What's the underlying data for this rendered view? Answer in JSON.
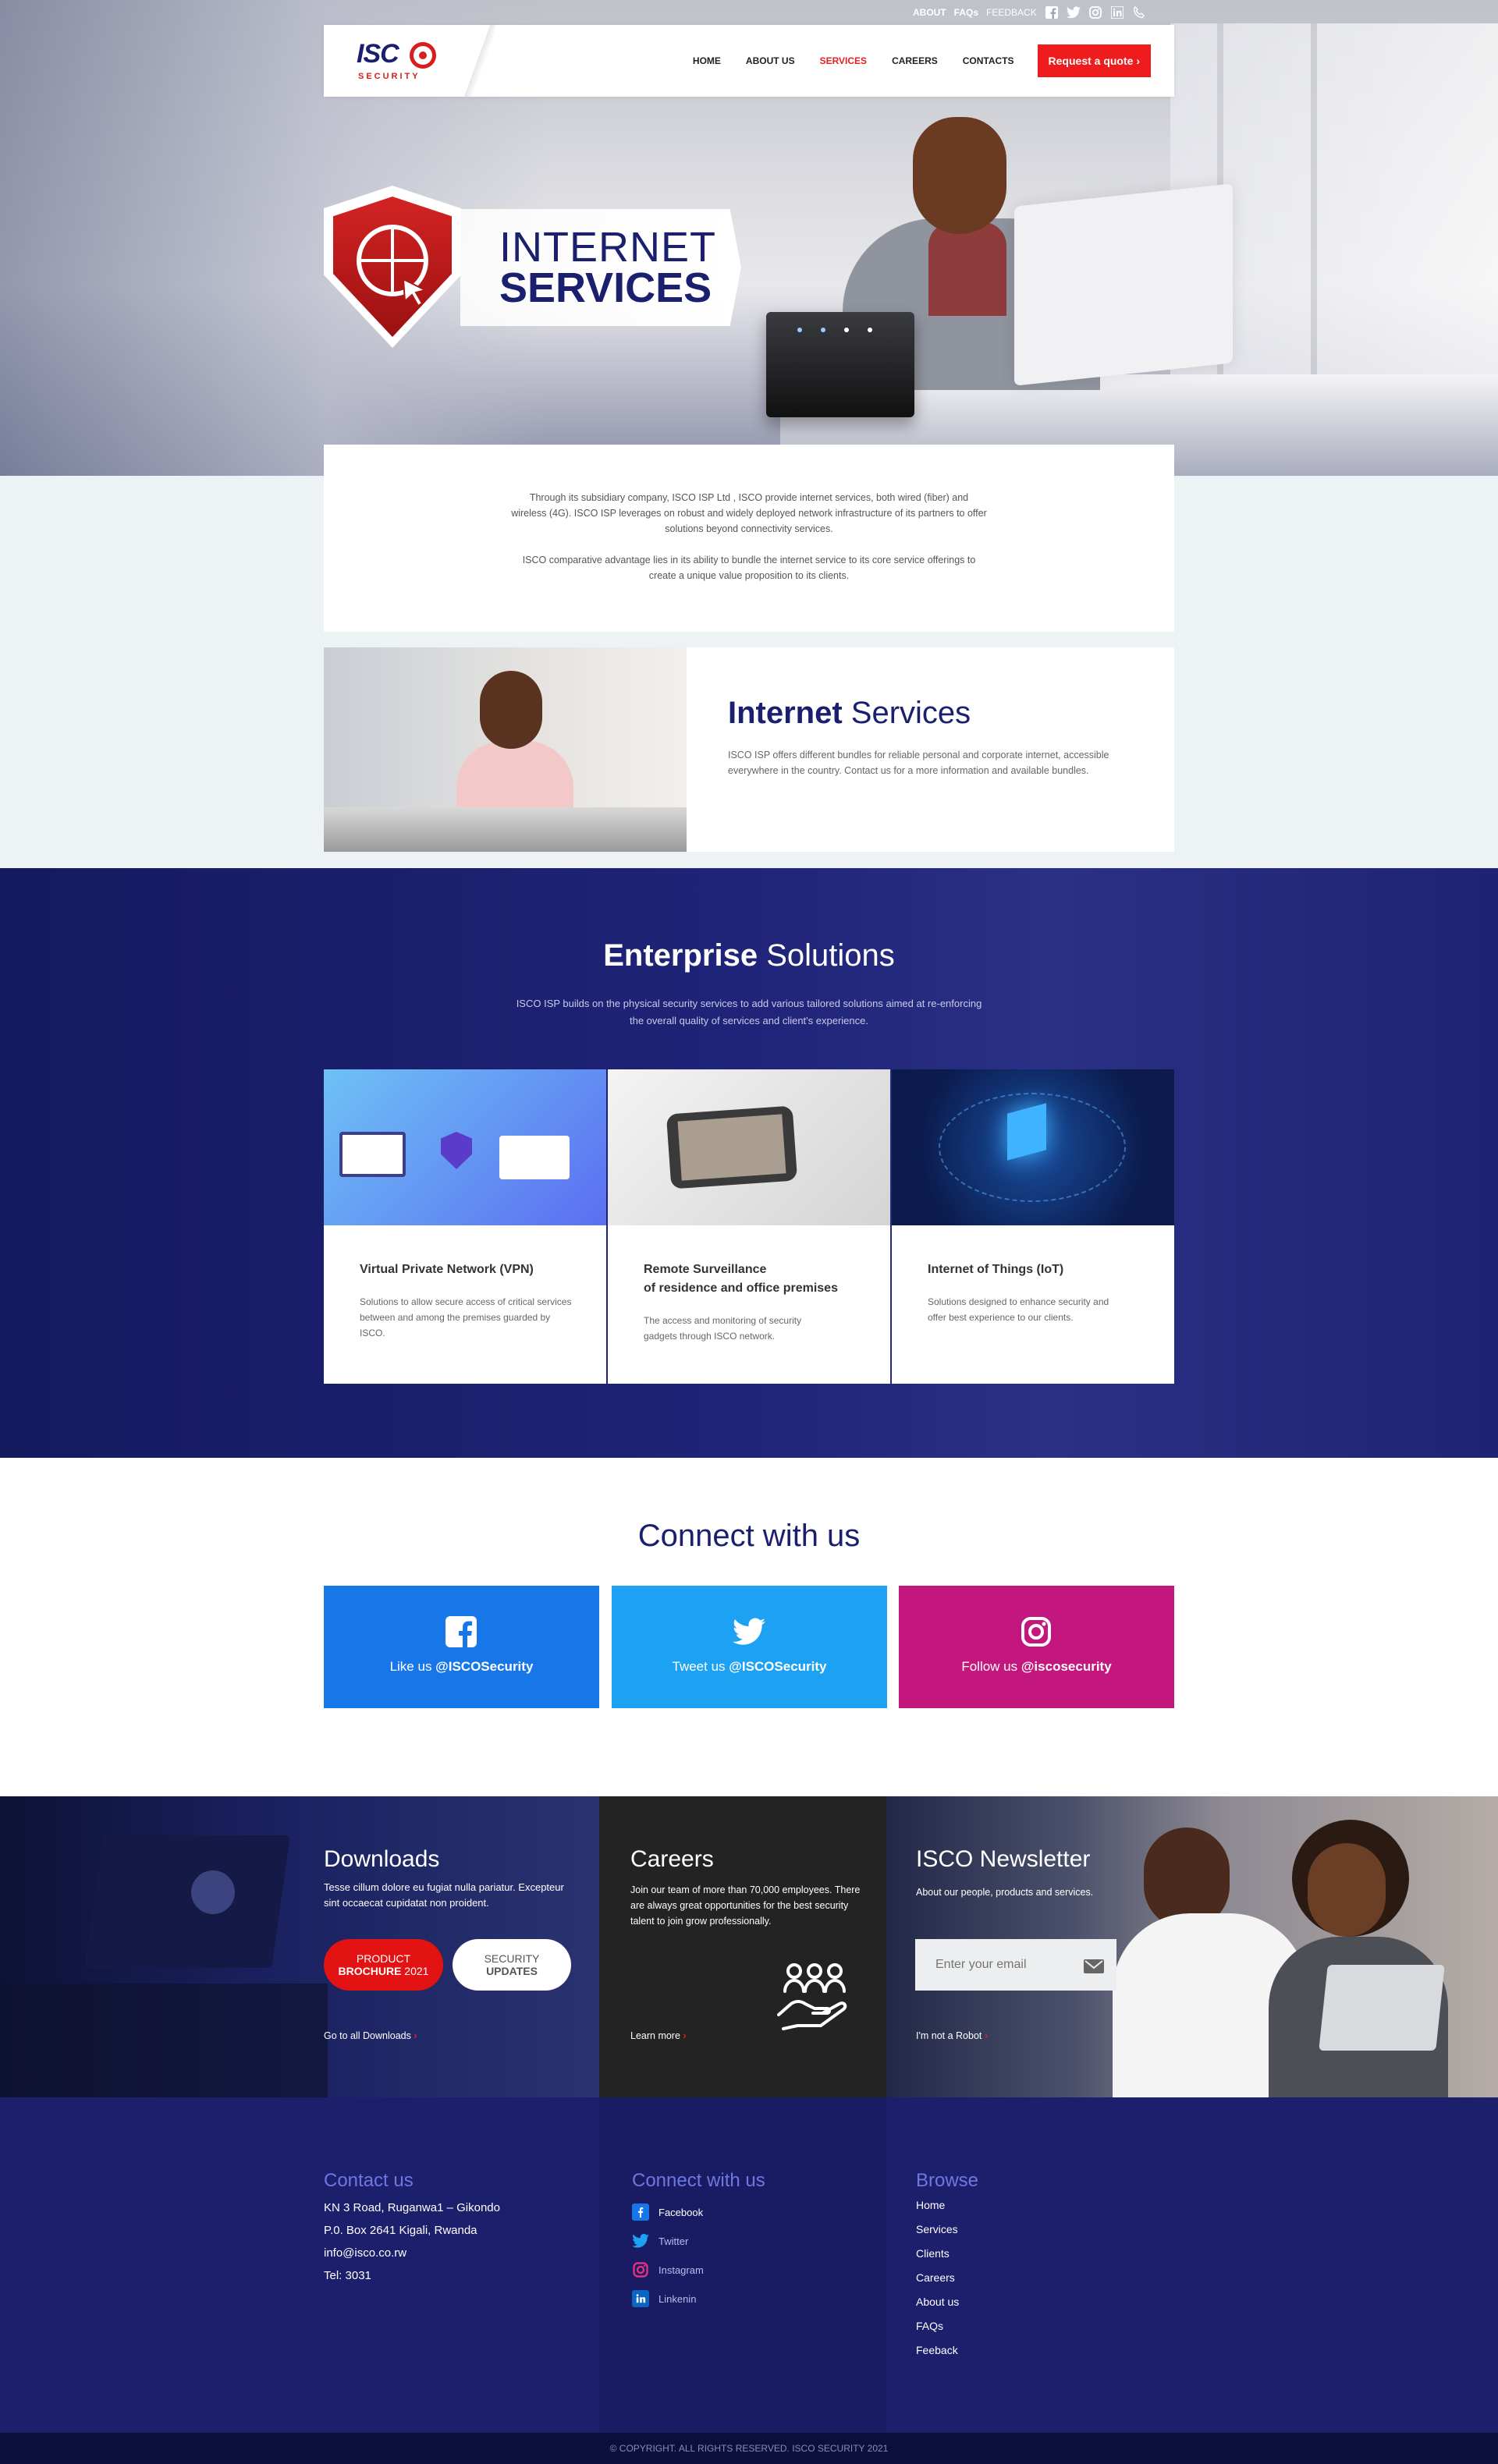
{
  "topbar": {
    "about": "ABOUT",
    "faqs": "FAQs",
    "feedback": "FEEDBACK"
  },
  "logo": {
    "text": "ISC",
    "subtext": "SECURITY"
  },
  "nav": {
    "items": [
      "HOME",
      "ABOUT US",
      "SERVICES",
      "CAREERS",
      "CONTACTS"
    ],
    "active": "SERVICES",
    "quote": "Request a quote ›"
  },
  "hero": {
    "line1": "INTERNET",
    "line2": "SERVICES"
  },
  "intro": {
    "p1": "Through its subsidiary company, ISCO ISP Ltd , ISCO provide internet services, both wired (fiber) and wireless (4G). ISCO ISP leverages on robust and widely deployed network infrastructure of its partners to offer solutions beyond connectivity services.",
    "p2": "ISCO comparative advantage lies in its  ability to bundle the internet service to its core service offerings to create a unique value proposition to its clients."
  },
  "internet_services": {
    "title_bold": "Internet",
    "title_rest": " Services",
    "text": "ISCO ISP offers different bundles for reliable personal and corporate internet, accessible everywhere in the country. Contact us for a more information and available bundles."
  },
  "enterprise": {
    "title_bold": "Enterprise",
    "title_rest": " Solutions",
    "subtitle": "ISCO ISP builds on the physical security services to add various tailored solutions aimed at re-enforcing the overall quality of services and client's experience.",
    "cards": [
      {
        "title": "Virtual Private Network (VPN)",
        "text": "Solutions to allow secure access of critical services between and among the premises guarded by ISCO."
      },
      {
        "title": "Remote Surveillance\nof residence and office premises",
        "title1": "Remote Surveillance",
        "title2": "of residence and office premises",
        "text": "The access and monitoring of security gadgets through ISCO network."
      },
      {
        "title": "Internet of Things (IoT)",
        "text": "Solutions designed to enhance security and offer best experience to our clients."
      }
    ]
  },
  "connect": {
    "title": "Connect with us",
    "facebook": {
      "prefix": "Like us ",
      "handle": "@ISCOSecurity",
      "color": "#1877e8"
    },
    "twitter": {
      "prefix": "Tweet us ",
      "handle": "@ISCOSecurity",
      "color": "#1da1f2"
    },
    "instagram": {
      "prefix": "Follow us ",
      "handle": "@iscosecurity",
      "color": "#c3177e"
    }
  },
  "downloads": {
    "title": "Downloads",
    "text": "Tesse cillum dolore eu fugiat nulla pariatur. Excepteur sint occaecat cupidatat non proident.",
    "brochure_l1": "PRODUCT",
    "brochure_l2a": "BROCHURE",
    "brochure_l2b": " 2021",
    "updates_l1": "SECURITY",
    "updates_l2": "UPDATES",
    "more": "Go to all Downloads"
  },
  "careers": {
    "title": "Careers",
    "text": "Join our team of more than 70,000 employees. There are always great opportunities for the best security talent to join grow professionally.",
    "more": "Learn more"
  },
  "newsletter": {
    "title": "ISCO Newsletter",
    "text": "About our people, products and services.",
    "placeholder": "Enter your email",
    "more": "I'm not a Robot"
  },
  "footer": {
    "contact_title": "Contact us",
    "contact_lines": [
      "KN 3 Road, Ruganwa1 – Gikondo",
      "P.0. Box 2641 Kigali, Rwanda",
      "info@isco.co.rw",
      "Tel: 3031"
    ],
    "connect_title": "Connect with us",
    "social": [
      "Facebook",
      "Twitter",
      "Instagram",
      "Linkenin"
    ],
    "browse_title": "Browse",
    "browse": [
      "Home",
      "Services",
      "Clients",
      "Careers",
      "About us",
      "FAQs",
      "Feeback"
    ],
    "copyright": "© COPYRIGHT. ALL RIGHTS RESERVED. ISCO SECURITY 2021"
  }
}
